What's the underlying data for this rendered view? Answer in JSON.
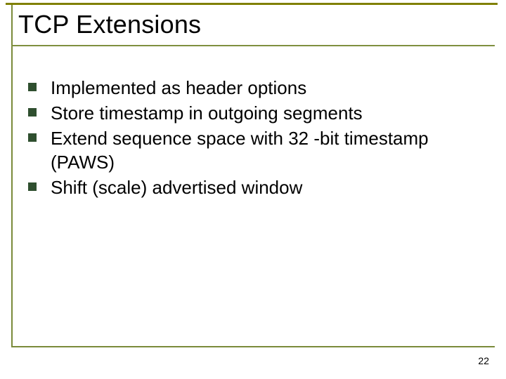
{
  "slide": {
    "title": "TCP Extensions",
    "bullets": [
      "Implemented as header options",
      "Store timestamp in outgoing segments",
      "Extend sequence space with 32 -bit timestamp (PAWS)",
      "Shift (scale) advertised window"
    ],
    "page_number": "22"
  },
  "colors": {
    "accent": "#7a8a3a",
    "bullet": "#2f4f2f"
  }
}
